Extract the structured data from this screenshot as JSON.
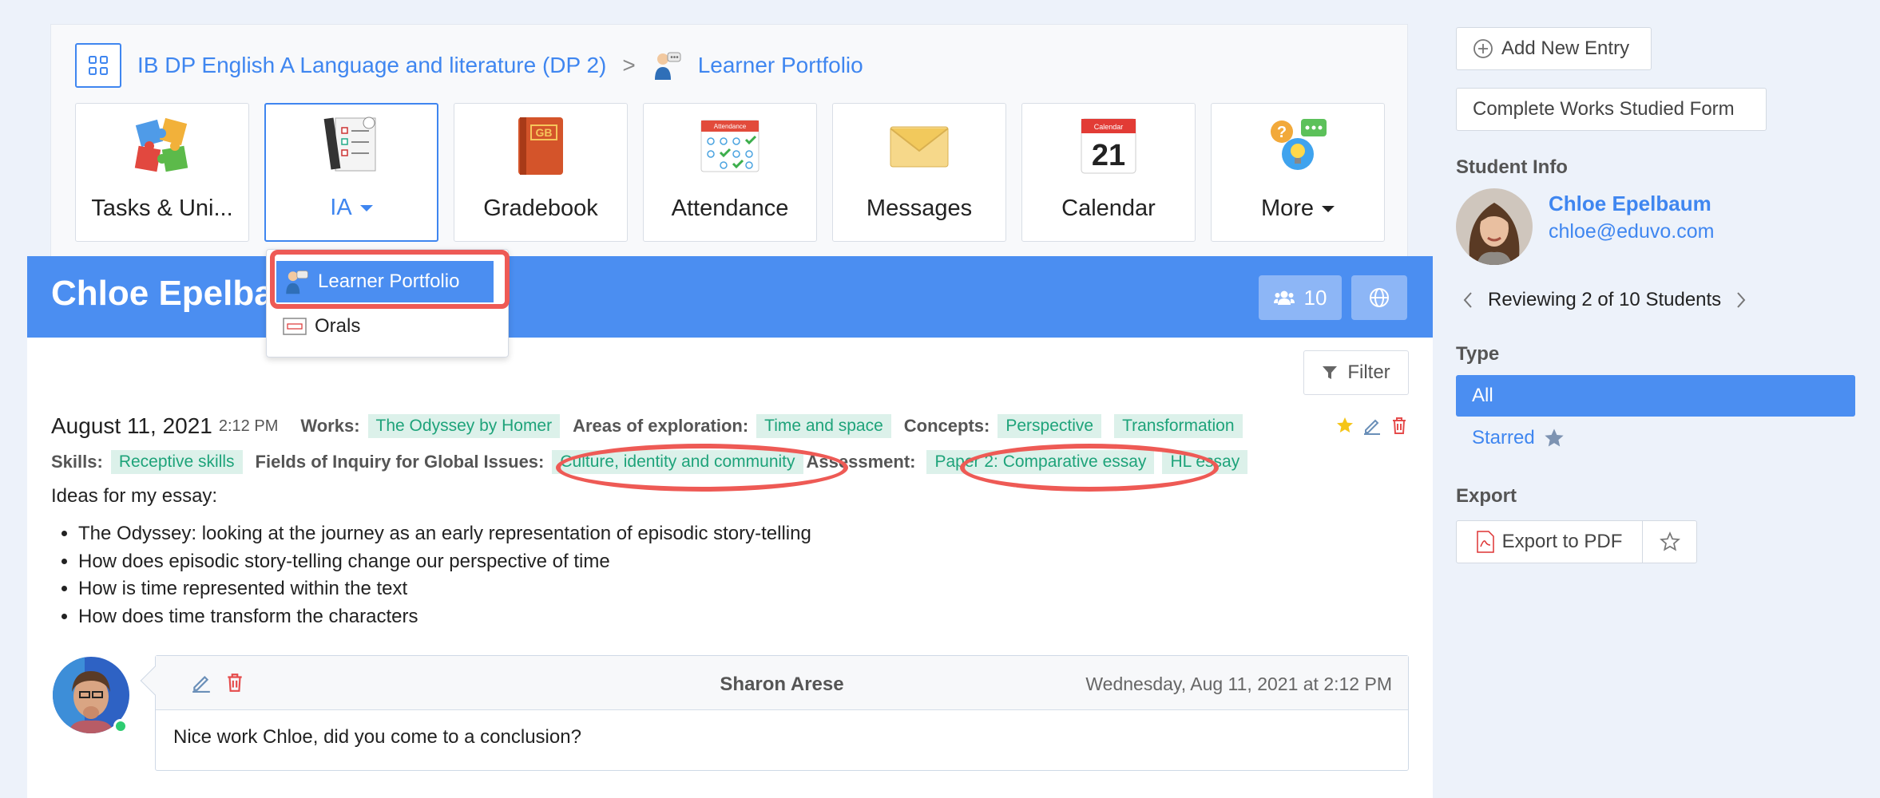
{
  "breadcrumb": {
    "course": "IB DP English A Language and literature (DP 2)",
    "separator": ">",
    "current": "Learner Portfolio"
  },
  "tiles": [
    {
      "label": "Tasks & Uni...",
      "icon": "puzzle-icon"
    },
    {
      "label": "IA",
      "icon": "checklist-icon"
    },
    {
      "label": "Gradebook",
      "icon": "gradebook-icon"
    },
    {
      "label": "Attendance",
      "icon": "attendance-icon"
    },
    {
      "label": "Messages",
      "icon": "envelope-icon"
    },
    {
      "label": "Calendar",
      "icon": "calendar-icon"
    },
    {
      "label": "More",
      "icon": "help-bubble-icon"
    }
  ],
  "tile_art": {
    "gradebook": "GB",
    "attendance": "Attendance",
    "calendar_month": "Calendar",
    "calendar_day": "21"
  },
  "dropdown": {
    "items": [
      {
        "label": "Learner Portfolio",
        "selected": true
      },
      {
        "label": "Orals",
        "selected": false
      }
    ]
  },
  "main": {
    "student_name": "Chloe Epelbaum",
    "student_count": "10",
    "filter_label": "Filter"
  },
  "entry": {
    "date": "August 11, 2021",
    "time": "2:12 PM",
    "works_label": "Works:",
    "works": [
      "The Odyssey by Homer"
    ],
    "areas_label": "Areas of exploration:",
    "areas": [
      "Time and space"
    ],
    "concepts_label": "Concepts:",
    "concepts": [
      "Perspective",
      "Transformation"
    ],
    "skills_label": "Skills:",
    "skills": [
      "Receptive skills"
    ],
    "fields_label": "Fields of Inquiry for Global Issues:",
    "fields": [
      "Culture, identity and community"
    ],
    "assessment_label": "Assessment:",
    "assessment": [
      "Paper 2: Comparative essay",
      "HL essay"
    ],
    "intro": "Ideas for my essay:",
    "bullets": [
      "The Odyssey: looking at the journey as an early representation of episodic story-telling",
      "How does episodic story-telling change our perspective of time",
      "How is time represented within the text",
      "How does time transform the characters"
    ]
  },
  "comment": {
    "author": "Sharon Arese",
    "date": "Wednesday, Aug 11, 2021 at 2:12 PM",
    "body": "Nice work Chloe, did you come to a conclusion?"
  },
  "sidebar": {
    "add_entry": "Add New Entry",
    "complete_works": "Complete Works Studied Form",
    "student_info_heading": "Student Info",
    "student_name": "Chloe Epelbaum",
    "student_email": "chloe@eduvo.com",
    "reviewing": "Reviewing 2 of 10 Students",
    "type_heading": "Type",
    "type_all": "All",
    "type_starred": "Starred",
    "export_heading": "Export",
    "export_pdf": "Export to PDF"
  },
  "colors": {
    "accent": "#4b8ef1",
    "link": "#3f86f0",
    "tag_bg": "#dcf1ea",
    "tag_text": "#1ea37a",
    "annotation": "#ee5a55"
  }
}
